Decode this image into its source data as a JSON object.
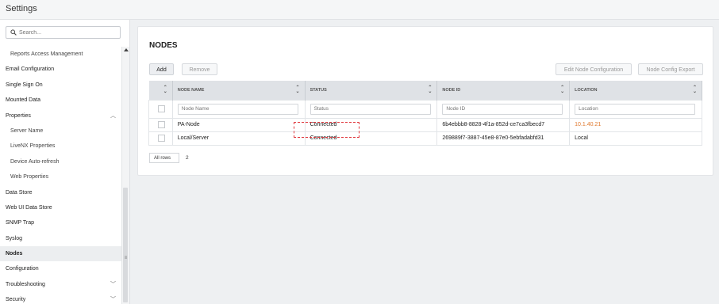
{
  "window": {
    "title": "Settings"
  },
  "sidebar": {
    "search_placeholder": "Search...",
    "items": [
      {
        "label": "Reports Access Management",
        "sub": true
      },
      {
        "label": "Email Configuration"
      },
      {
        "label": "Single Sign On"
      },
      {
        "label": "Mounted Data"
      },
      {
        "label": "Properties",
        "expanded": true
      },
      {
        "label": "Server Name",
        "sub": true
      },
      {
        "label": "LiveNX Properties",
        "sub": true
      },
      {
        "label": "Device Auto-refresh",
        "sub": true
      },
      {
        "label": "Web Properties",
        "sub": true
      },
      {
        "label": "Data Store"
      },
      {
        "label": "Web UI Data Store"
      },
      {
        "label": "SNMP Trap"
      },
      {
        "label": "Syslog"
      },
      {
        "label": "Nodes",
        "active": true
      },
      {
        "label": "Configuration"
      },
      {
        "label": "Troubleshooting",
        "collapsible": true
      },
      {
        "label": "Security",
        "collapsible": true
      }
    ]
  },
  "panel": {
    "title": "NODES",
    "buttons": {
      "add": "Add",
      "remove": "Remove",
      "edit": "Edit Node Configuration",
      "export": "Node Config Export"
    },
    "columns": [
      "NODE NAME",
      "STATUS",
      "NODE ID",
      "LOCATION"
    ],
    "filters": [
      "Node Name",
      "Status",
      "Node ID",
      "Location"
    ],
    "rows": [
      {
        "name": "PA-Node",
        "status": "Connected",
        "id": "6b4ebbb8-8828-4f1a-852d-ce7ca3fbecd7",
        "location": "10.1.40.21"
      },
      {
        "name": "Local/Server",
        "status": "Connected",
        "id": "269889f7-3887-45e8-87e0-5ebfadabfd31",
        "location": "Local"
      }
    ],
    "rows_select": "All rows",
    "row_count": "2"
  },
  "colors": {
    "link": "#e0782c",
    "highlight": "#e0363c",
    "header_bg": "#dfe2e6"
  }
}
